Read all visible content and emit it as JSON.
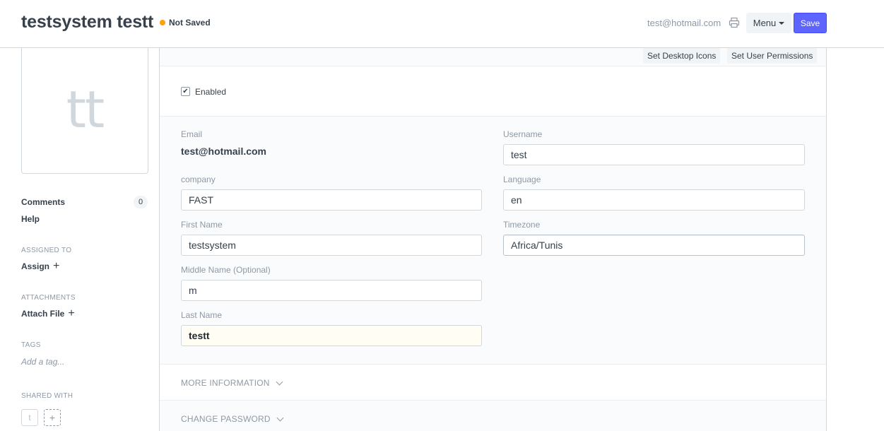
{
  "header": {
    "title": "testsystem testt",
    "status": "Not Saved",
    "status_color": "#ffa00a",
    "user_email": "test@hotmail.com",
    "menu_label": "Menu",
    "save_label": "Save",
    "accent_color": "#5e64ff"
  },
  "sidebar": {
    "avatar_initials": "tt",
    "comments_label": "Comments",
    "comments_count": "0",
    "help_label": "Help",
    "assigned_to_heading": "ASSIGNED TO",
    "assign_label": "Assign",
    "attachments_heading": "ATTACHMENTS",
    "attach_label": "Attach File",
    "tags_heading": "TAGS",
    "tag_placeholder": "Add a tag...",
    "shared_with_heading": "SHARED WITH",
    "shared_user_initial": "t"
  },
  "form": {
    "links": {
      "desktop_icons": "Set Desktop Icons",
      "user_permissions": "Set User Permissions"
    },
    "enabled_label": "Enabled",
    "enabled_checked": true,
    "fields": {
      "email_label": "Email",
      "email_value": "test@hotmail.com",
      "username_label": "Username",
      "username_value": "test",
      "company_label": "company",
      "company_value": "FAST",
      "language_label": "Language",
      "language_value": "en",
      "first_name_label": "First Name",
      "first_name_value": "testsystem",
      "timezone_label": "Timezone",
      "timezone_value": "Africa/Tunis",
      "middle_name_label": "Middle Name (Optional)",
      "middle_name_value": "m",
      "last_name_label": "Last Name",
      "last_name_value": "testt"
    },
    "sections": {
      "more_information": "MORE INFORMATION",
      "change_password": "CHANGE PASSWORD"
    }
  }
}
